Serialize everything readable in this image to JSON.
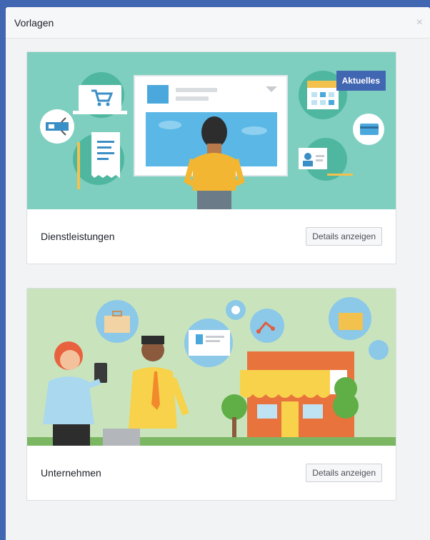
{
  "dialog": {
    "title": "Vorlagen",
    "close_glyph": "×"
  },
  "cards": [
    {
      "name": "Dienstleistungen",
      "button_label": "Details anzeigen",
      "badge": "Aktuelles",
      "illustration": "services-illustration",
      "bg_color": "#7ecfbf"
    },
    {
      "name": "Unternehmen",
      "button_label": "Details anzeigen",
      "illustration": "business-illustration",
      "bg_color": "#c9e4bd"
    }
  ],
  "colors": {
    "accent": "#4267b2",
    "page_bg": "#3b5998"
  }
}
